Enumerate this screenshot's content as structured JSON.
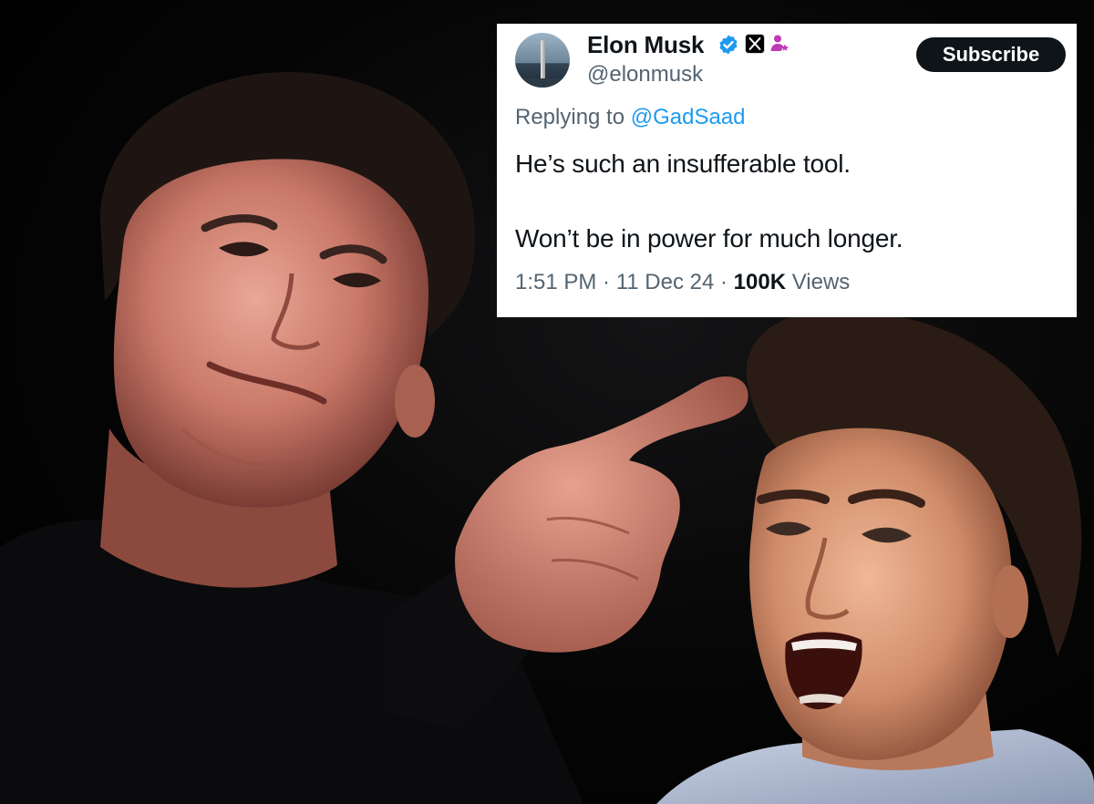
{
  "tweet": {
    "display_name": "Elon Musk",
    "handle": "@elonmusk",
    "subscribe_label": "Subscribe",
    "replying_prefix": "Replying to ",
    "replying_to": "@GadSaad",
    "text_line_1": "He’s such an insufferable tool.",
    "text_line_2": "Won’t be in power for much longer.",
    "time": "1:51 PM",
    "separator": " · ",
    "date": "11 Dec 24",
    "views_count": "100K",
    "views_label": " Views",
    "verified_color": "#1d9bf0",
    "affiliate_color": "#c13ab6"
  },
  "scene": {
    "left_person_icon": "person-pointing-photo",
    "right_person_icon": "person-shouting-photo",
    "background_color": "#000000"
  }
}
